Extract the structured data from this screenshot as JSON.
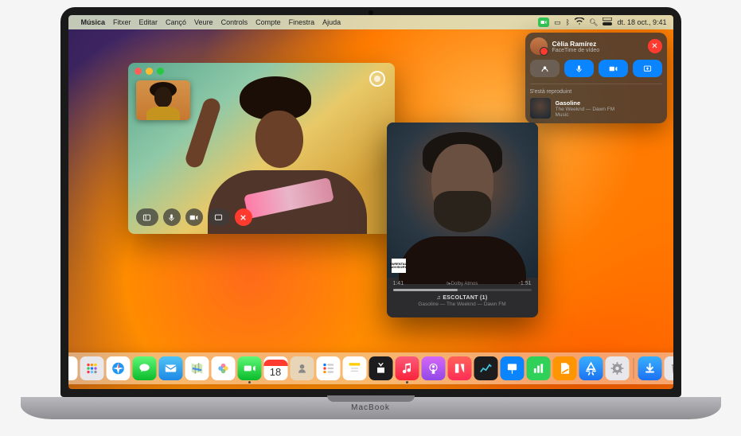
{
  "menubar": {
    "app": "Música",
    "items": [
      "Fitxer",
      "Editar",
      "Cançó",
      "Veure",
      "Controls",
      "Compte",
      "Finestra",
      "Ajuda"
    ],
    "datetime": "dt. 18 oct., 9:41"
  },
  "popover": {
    "caller_name": "Cèlia Ramírez",
    "call_type": "FaceTime de vídeo",
    "close_glyph": "✕",
    "now_playing_label": "S'està reproduint",
    "np_title": "Gasoline",
    "np_artist": "The Weeknd — Dawn FM",
    "np_app": "Music"
  },
  "music": {
    "elapsed": "1:41",
    "remaining": "-1:51",
    "dolby": "◊▸Dolby Atmos",
    "listening": "♫ ESCOLTANT (1)",
    "track_line": "Gasoline — The Weeknd — Dawn FM",
    "parental": "PARENTAL ADVISORY"
  },
  "brand": "MacBook",
  "calendar_day": "18"
}
